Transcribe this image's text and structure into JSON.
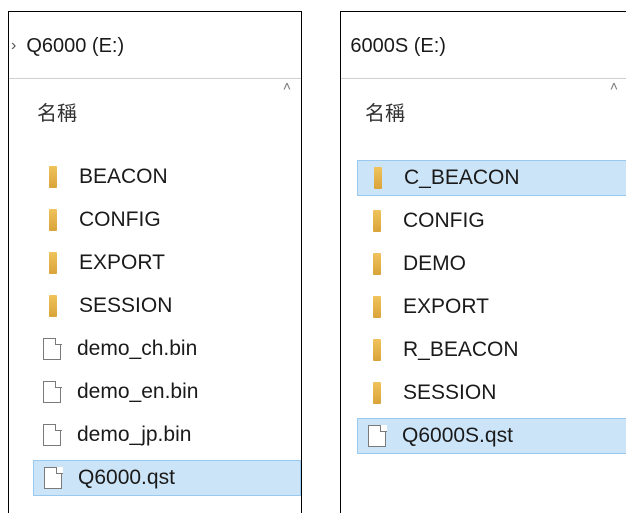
{
  "left_pane": {
    "path": "Q6000 (E:)",
    "column_header": "名稱",
    "items": [
      {
        "name": "BEACON",
        "type": "folder"
      },
      {
        "name": "CONFIG",
        "type": "folder"
      },
      {
        "name": "EXPORT",
        "type": "folder"
      },
      {
        "name": "SESSION",
        "type": "folder"
      },
      {
        "name": "demo_ch.bin",
        "type": "file"
      },
      {
        "name": "demo_en.bin",
        "type": "file"
      },
      {
        "name": "demo_jp.bin",
        "type": "file"
      },
      {
        "name": "Q6000.qst",
        "type": "file",
        "selected": true
      }
    ]
  },
  "right_pane": {
    "path": "6000S (E:)",
    "column_header": "名稱",
    "items": [
      {
        "name": "C_BEACON",
        "type": "folder",
        "selected": true
      },
      {
        "name": "CONFIG",
        "type": "folder"
      },
      {
        "name": "DEMO",
        "type": "folder"
      },
      {
        "name": "EXPORT",
        "type": "folder"
      },
      {
        "name": "R_BEACON",
        "type": "folder"
      },
      {
        "name": "SESSION",
        "type": "folder"
      },
      {
        "name": "Q6000S.qst",
        "type": "file",
        "selected": true
      }
    ]
  },
  "icons": {
    "chevron": "chevron-right-icon",
    "sort": "sort-up-caret-icon",
    "folder": "folder-icon",
    "file": "file-icon"
  },
  "colors": {
    "selection_bg": "#cce4f7",
    "selection_border": "#99c9ef",
    "folder": "#e8b84a"
  }
}
